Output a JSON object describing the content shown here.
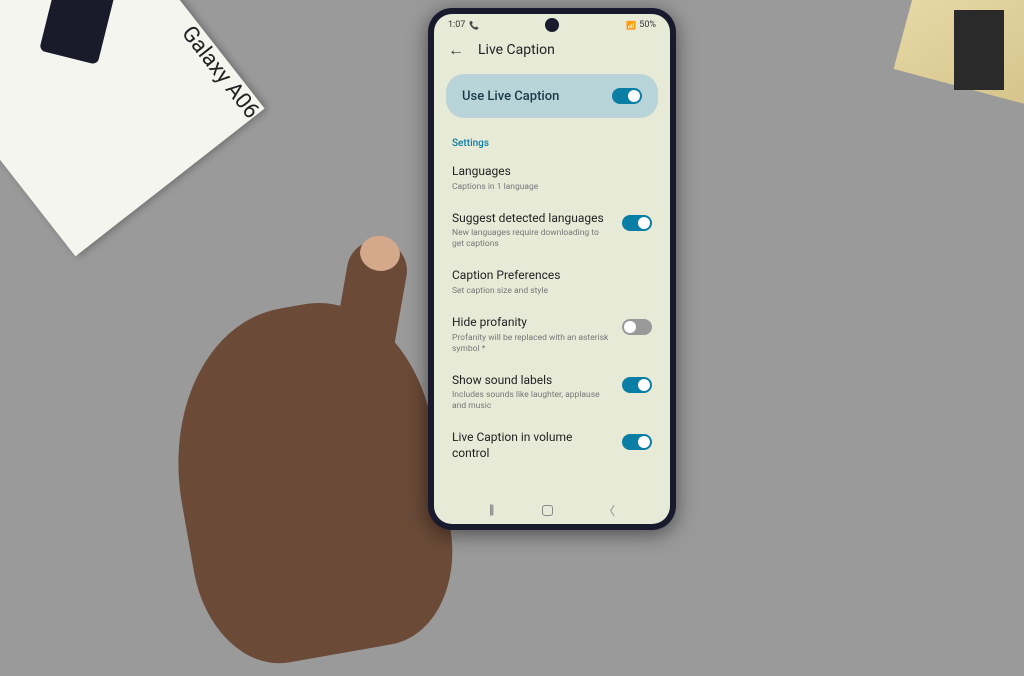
{
  "status_bar": {
    "time": "1:07",
    "battery": "50%"
  },
  "header": {
    "title": "Live Caption"
  },
  "main_toggle": {
    "label": "Use Live Caption",
    "enabled": true
  },
  "section_label": "Settings",
  "settings": [
    {
      "title": "Languages",
      "desc": "Captions in 1 language",
      "has_toggle": false
    },
    {
      "title": "Suggest detected languages",
      "desc": "New languages require downloading to get captions",
      "has_toggle": true,
      "toggle_on": true
    },
    {
      "title": "Caption Preferences",
      "desc": "Set caption size and style",
      "has_toggle": false
    },
    {
      "title": "Hide profanity",
      "desc": "Profanity will be replaced with an asterisk symbol *",
      "has_toggle": true,
      "toggle_on": false
    },
    {
      "title": "Show sound labels",
      "desc": "Includes sounds like laughter, applause and music",
      "has_toggle": true,
      "toggle_on": true
    },
    {
      "title": "Live Caption in volume control",
      "desc": "",
      "has_toggle": true,
      "toggle_on": true
    }
  ],
  "box_label": "Galaxy A06"
}
